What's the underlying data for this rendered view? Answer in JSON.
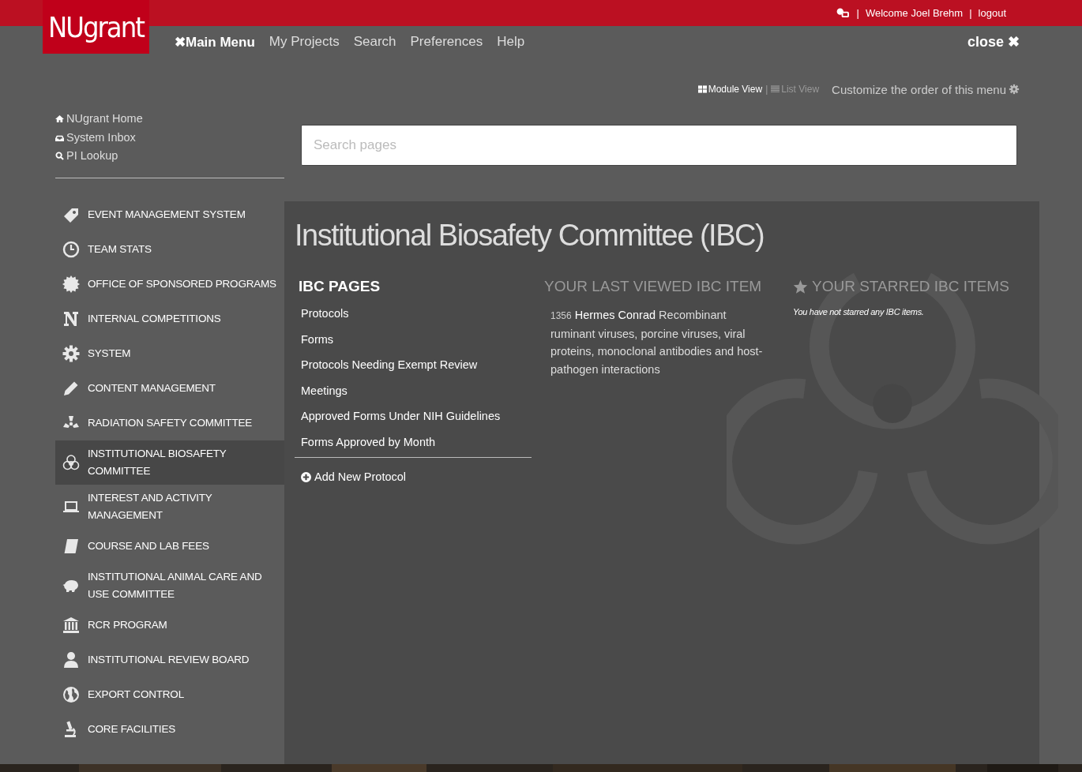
{
  "top_bar": {
    "separators": [
      "|",
      "|"
    ],
    "welcome": "Welcome Joel Brehm",
    "logout": "logout"
  },
  "logo": "NUgrant",
  "nav": [
    {
      "label": "Main Menu",
      "mark": "✖",
      "selected": true
    },
    {
      "label": "My Projects",
      "selected": false
    },
    {
      "label": "Search",
      "selected": false
    },
    {
      "label": "Preferences",
      "selected": false
    },
    {
      "label": "Help",
      "selected": false
    }
  ],
  "close": {
    "label": "close",
    "mark": "✖"
  },
  "view_switch": [
    {
      "label": "Module View",
      "selected": true
    },
    {
      "label": "List View",
      "selected": false
    }
  ],
  "view_separator": "|",
  "customize": "Customize the order of this menu",
  "quick_links": [
    "NUgrant Home",
    "System Inbox",
    "PI Lookup"
  ],
  "search": {
    "placeholder": "Search pages"
  },
  "modules": [
    {
      "label": "EVENT MANAGEMENT SYSTEM",
      "selected": false
    },
    {
      "label": "TEAM STATS",
      "selected": false
    },
    {
      "label": "OFFICE OF SPONSORED PROGRAMS",
      "selected": false
    },
    {
      "label": "INTERNAL COMPETITIONS",
      "selected": false
    },
    {
      "label": "SYSTEM",
      "selected": false
    },
    {
      "label": "CONTENT MANAGEMENT",
      "selected": false
    },
    {
      "label": "RADIATION SAFETY COMMITTEE",
      "selected": false
    },
    {
      "label": "INSTITUTIONAL BIOSAFETY COMMITTEE",
      "selected": true
    },
    {
      "label": "INTEREST AND ACTIVITY MANAGEMENT",
      "selected": false
    },
    {
      "label": "COURSE AND LAB FEES",
      "selected": false
    },
    {
      "label": "INSTITUTIONAL ANIMAL CARE AND USE COMMITTEE",
      "selected": false
    },
    {
      "label": "RCR PROGRAM",
      "selected": false
    },
    {
      "label": "INSTITUTIONAL REVIEW BOARD",
      "selected": false
    },
    {
      "label": "EXPORT CONTROL",
      "selected": false
    },
    {
      "label": "CORE FACILITIES",
      "selected": false
    }
  ],
  "panel": {
    "title": "Institutional Biosafety Committee (IBC)",
    "pages_heading": "IBC PAGES",
    "pages": [
      "Protocols",
      "Forms",
      "Protocols Needing Exempt Review",
      "Meetings",
      "Approved Forms Under NIH Guidelines",
      "Forms Approved by Month"
    ],
    "add_action": "Add New Protocol",
    "last_viewed": {
      "heading": "YOUR LAST VIEWED IBC ITEM",
      "id": "1356",
      "name": "Hermes Conrad",
      "description": "Recombinant ruminant viruses, porcine viruses, viral proteins, monoclonal antibodies and host-pathogen interactions"
    },
    "starred": {
      "heading": "YOUR STARRED IBC ITEMS",
      "empty_note": "You have not starred any IBC items."
    }
  }
}
